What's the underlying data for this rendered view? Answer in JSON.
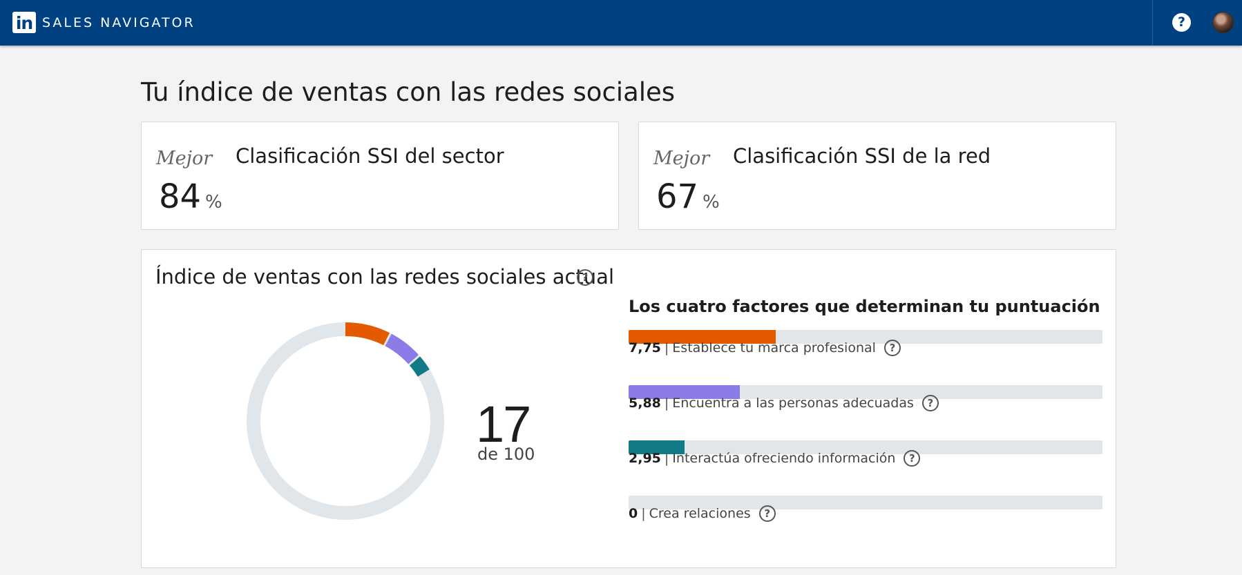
{
  "header": {
    "logo_text": "in",
    "brand": "SALES NAVIGATOR",
    "help_icon": "question-circle-icon",
    "help_label": "?"
  },
  "page": {
    "title": "Tu índice de ventas con las redes sociales"
  },
  "rankings": [
    {
      "qualifier": "Mejor",
      "title": "Clasificación SSI del sector",
      "value": "84",
      "unit": "%"
    },
    {
      "qualifier": "Mejor",
      "title": "Clasificación SSI de la red",
      "value": "67",
      "unit": "%"
    }
  ],
  "ssi": {
    "title": "Índice de ventas con las redes sociales actual",
    "help_label": "?",
    "score": "17",
    "score_of": "de 100",
    "factors_title": "Los cuatro factores que determinan tu puntuación",
    "factor_help_label": "?",
    "factors": [
      {
        "value": "7,75",
        "label": "Establece tu marca profesional",
        "score": 7.75,
        "max": 25,
        "color": "#e35a00"
      },
      {
        "value": "5,88",
        "label": "Encuentra a las personas adecuadas",
        "score": 5.88,
        "max": 25,
        "color": "#8a7be6"
      },
      {
        "value": "2,95",
        "label": "Interactúa ofreciendo información",
        "score": 2.95,
        "max": 25,
        "color": "#127b88"
      },
      {
        "value": "0",
        "label": "Crea relaciones",
        "score": 0,
        "max": 25,
        "color": "#e35a00"
      }
    ],
    "ring_color": "#e1e6ea"
  }
}
